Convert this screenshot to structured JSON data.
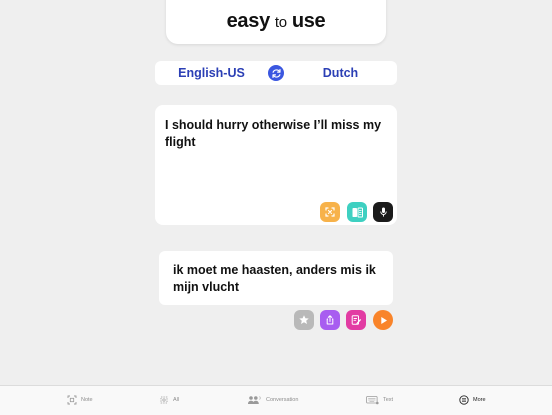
{
  "headline": {
    "part1": "easy",
    "part2": "to",
    "part3": "use"
  },
  "languages": {
    "source": "English-US",
    "target": "Dutch"
  },
  "source_text": "I should hurry otherwise I’ll miss my flight",
  "translation_text": "ik moet me haasten, anders mis ik mijn vlucht",
  "colors": {
    "accent": "#3b57e0",
    "lang_text": "#2b3fb5",
    "orange": "#f7b24a",
    "teal": "#3ed0c1",
    "purple": "#a85df0",
    "pink": "#e23ca3",
    "play": "#f9842a",
    "grey": "#b9b9b9"
  },
  "source_actions": [
    "expand-icon",
    "document-icon",
    "microphone-icon"
  ],
  "translation_actions": [
    "star-icon",
    "share-icon",
    "edit-icon",
    "play-icon"
  ],
  "tabs": [
    {
      "label": "Note",
      "icon": "note-scan-icon"
    },
    {
      "label": "All",
      "icon": "all-icon"
    },
    {
      "label": "Conversation",
      "icon": "people-icon"
    },
    {
      "label": "Text",
      "icon": "keyboard-icon"
    },
    {
      "label": "More",
      "icon": "more-icon"
    }
  ]
}
